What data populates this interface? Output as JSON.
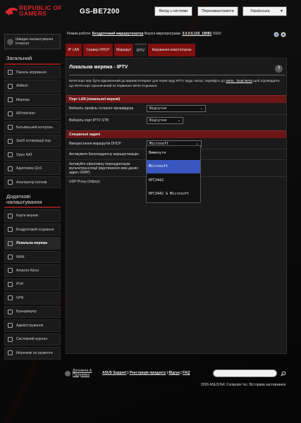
{
  "header": {
    "brand_line1": "REPUBLIC OF",
    "brand_line2": "GAMERS",
    "model": "GS-BE7200",
    "logout": "Вихід з системи",
    "reboot": "Перезавантажити",
    "language": "Українська"
  },
  "status": {
    "mode_label": "Режим роботи:",
    "mode_value": "Бездротовий маршрутизатор",
    "fw_label": "Версія мікропрограми:",
    "fw_value": "3.0.0.6.102_18083",
    "ssid_label": "SSID:"
  },
  "sidebar": {
    "quick": "Швидке налаштування Інтернет",
    "general_title": "Загальний",
    "general": [
      {
        "label": "Панель керування"
      },
      {
        "label": "AiMesh"
      },
      {
        "label": "Мережа"
      },
      {
        "label": "AiProtection"
      },
      {
        "label": "Батьківський контроль"
      },
      {
        "label": "Засіб оптимізації ігор"
      },
      {
        "label": "Open NAT"
      },
      {
        "label": "Адаптивна QoS"
      },
      {
        "label": "Аналізатор потоків"
      }
    ],
    "advanced_title": "Додаткові налаштування",
    "advanced": [
      {
        "label": "Карта мережі"
      },
      {
        "label": "Бездротовий з'єднання"
      },
      {
        "label": "Локальна мережа"
      },
      {
        "label": "WAN"
      },
      {
        "label": "Amazon Alexa"
      },
      {
        "label": "IPv6"
      },
      {
        "label": "VPN"
      },
      {
        "label": "Брандмауер"
      },
      {
        "label": "Адміністрування"
      },
      {
        "label": "Системний журнал"
      },
      {
        "label": "Мережеві інструменти"
      }
    ]
  },
  "tabs": [
    "IP LAN",
    "Сервер DHCP",
    "Маршрут",
    "IPTV",
    "Керування комутатором"
  ],
  "panel": {
    "title": "Локальна мережа - IPTV",
    "help": "?",
    "desc_part1": "WAN-порт має бути підключений до мережі Інтернет для перегляду IPTV. Будь-ласка, перейдіть до ",
    "desc_link": "WAN - Dual WAN",
    "desc_part2": " щоб підтвердити що WAN-порт призначений як первинне WAN-з'єднання.",
    "section1": "Порт LAN (локальної мережі)",
    "isp_profile_label": "Виберіть профіль Інтернет-провайдера",
    "isp_profile_value": "Відсутня",
    "stb_label": "Виберіть порт IPTV STB",
    "stb_value": "Відсутня",
    "section2": "Спеціальні задачі",
    "dhcp_route_label": "Використання маршрутів DHCP",
    "dhcp_route_value": "Microsoft",
    "multicast_label": "Активувати багатоадресну маршрутизацію",
    "igmp_label": "Активуйте ефективну переадресацію мультитрансляції (відстеження змін даних адрес IGMP)",
    "udpxy_label": "UDP Proxy (Udpxy)"
  },
  "dropdown": {
    "options": [
      "Вимкнути",
      "Microsoft",
      "RFC3442",
      "RFC3442 & Microsoft"
    ],
    "selected": "Microsoft"
  },
  "footer": {
    "help_line1": "Допомога &",
    "help_line2": "Підтримка",
    "links": [
      "ASUS Support",
      "Реєстрація продукту",
      "Відгук",
      "FAQ"
    ],
    "copyright": "2026 ASUSTeK Computer Inc. Всі права застережені."
  },
  "colors": {
    "accent": "#7e1010",
    "section_bar": "#6b1616",
    "highlight": "#3a57c0",
    "brand_red": "#d9262c"
  }
}
